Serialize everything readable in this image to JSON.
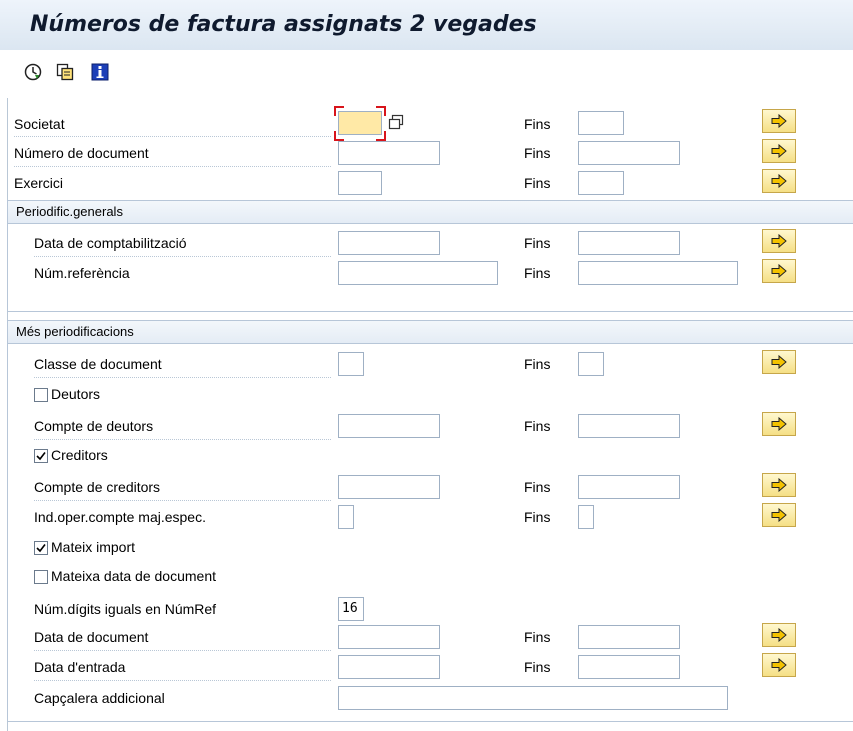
{
  "title": "Números de factura assignats 2 vegades",
  "toolbar": {
    "icons": [
      "execute-icon",
      "copy-variant-icon",
      "info-icon"
    ]
  },
  "fins_label": "Fins",
  "main": {
    "societat": "Societat",
    "numero_document": "Número de document",
    "exercici": "Exercici"
  },
  "group_general": {
    "header": "Periodific.generals",
    "data_comptabilitzacio": "Data de comptabilització",
    "num_referencia": "Núm.referència"
  },
  "group_more": {
    "header": "Més periodificacions",
    "classe_document": "Classe de document",
    "deutors": "Deutors",
    "deutors_checked": false,
    "compte_deutors": "Compte de deutors",
    "creditors": "Creditors",
    "creditors_checked": true,
    "compte_creditors": "Compte de creditors",
    "ind_oper": "Ind.oper.compte maj.espec.",
    "mateix_import": "Mateix import",
    "mateix_import_checked": true,
    "mateixa_data": "Mateixa data de document",
    "mateixa_data_checked": false,
    "num_digits": "Núm.dígits iguals en NúmRef",
    "num_digits_value": "16",
    "data_document": "Data de document",
    "data_entrada": "Data d'entrada",
    "capcalera": "Capçalera addicional"
  }
}
